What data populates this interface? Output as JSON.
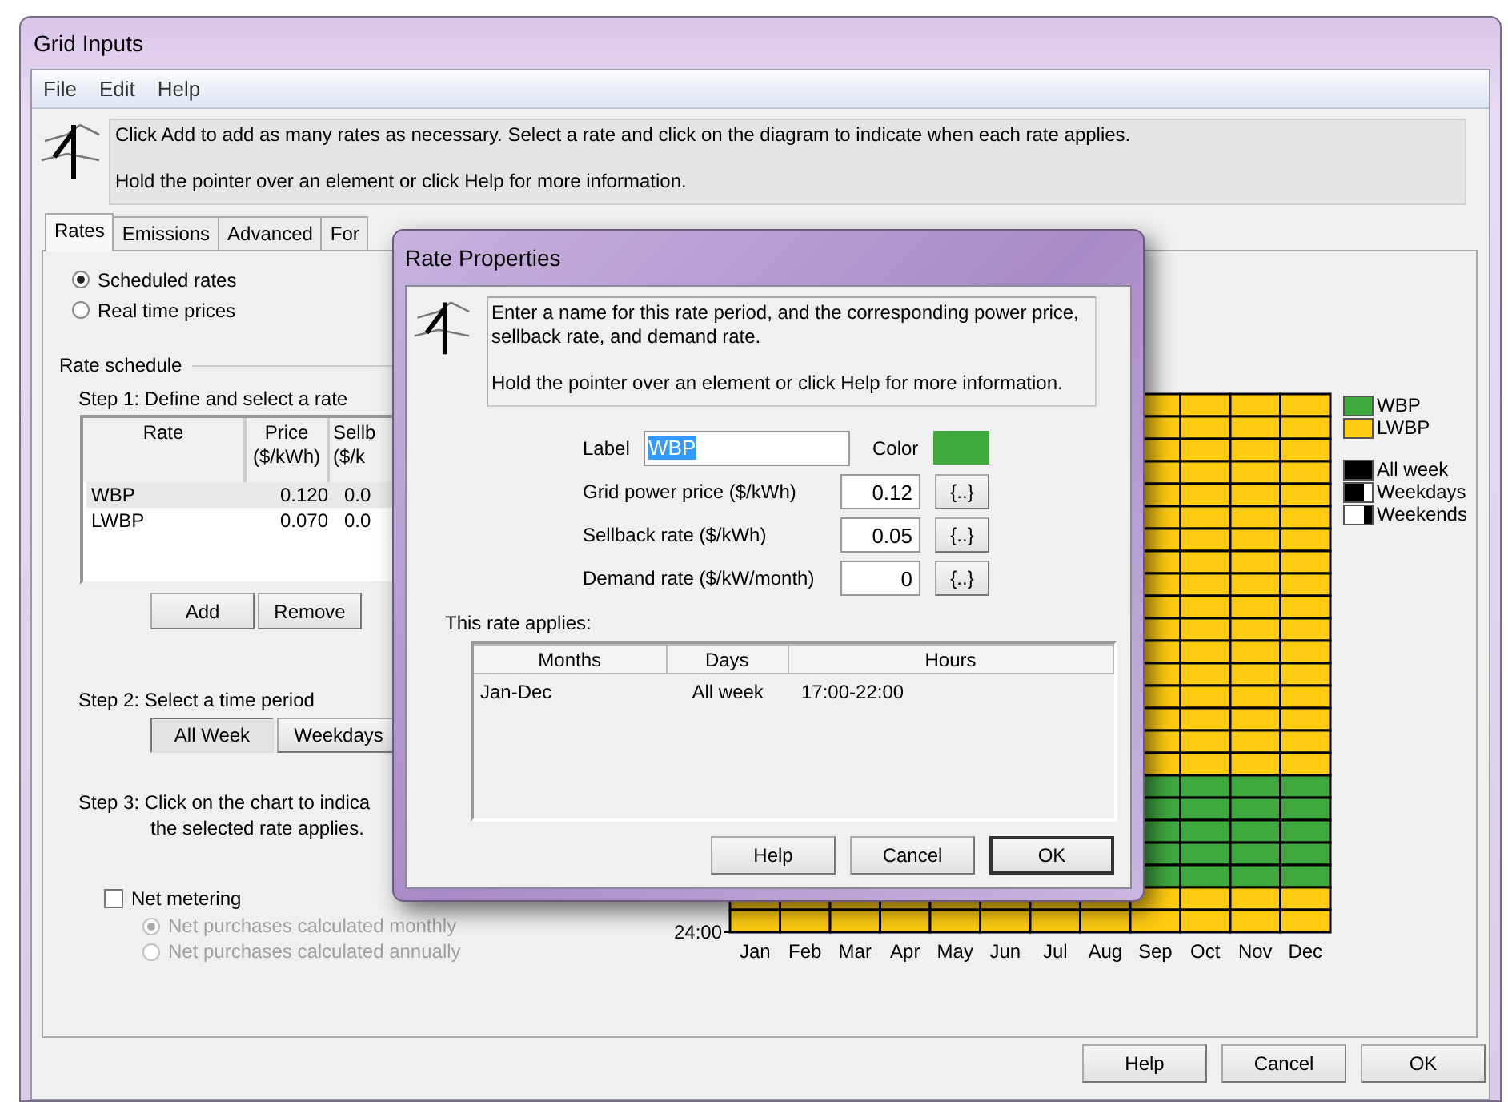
{
  "window": {
    "title": "Grid Inputs"
  },
  "menu": [
    "File",
    "Edit",
    "Help"
  ],
  "info": [
    "Click Add to add as many rates as necessary.  Select a rate and click on the diagram to indicate when each rate applies.",
    "Hold the pointer over an element or click Help for more information."
  ],
  "tabs": [
    {
      "label": "Rates",
      "selected": true
    },
    {
      "label": "Emissions",
      "selected": false
    },
    {
      "label": "Advanced",
      "selected": false
    },
    {
      "label": "For",
      "selected": false
    }
  ],
  "rate_type": [
    {
      "label": "Scheduled rates",
      "selected": true
    },
    {
      "label": "Real time prices",
      "selected": false
    }
  ],
  "rate_schedule": {
    "title": "Rate schedule",
    "step1": "Step 1:  Define and select a rate",
    "columns": [
      {
        "lines": [
          "Rate"
        ]
      },
      {
        "lines": [
          "Price",
          "($/kWh)"
        ]
      },
      {
        "lines": [
          "Sellb",
          "($/k"
        ]
      }
    ],
    "rows": [
      {
        "cells": [
          "WBP",
          "0.120",
          "0.0"
        ],
        "selected": true
      },
      {
        "cells": [
          "LWBP",
          "0.070",
          "0.0"
        ],
        "selected": false
      }
    ],
    "buttons": [
      "Add",
      "Remove"
    ],
    "step2": "Step 2:  Select a time period",
    "periods": [
      {
        "label": "All Week",
        "selected": true
      },
      {
        "label": "Weekdays",
        "selected": false
      }
    ],
    "step3": [
      "Step 3:  Click on the chart to indica",
      "the selected rate applies."
    ]
  },
  "net_metering": {
    "label": "Net metering",
    "checked": false,
    "options": [
      {
        "label": "Net purchases calculated monthly",
        "selected": true,
        "disabled": true
      },
      {
        "label": "Net purchases calculated annually",
        "selected": false,
        "disabled": true
      }
    ]
  },
  "chart": {
    "hour_label": "24:00",
    "months": [
      "Jan",
      "Feb",
      "Mar",
      "Apr",
      "May",
      "Jun",
      "Jul",
      "Aug",
      "Sep",
      "Oct",
      "Nov",
      "Dec"
    ],
    "hours": [
      {
        "kind": "lwbp"
      },
      {
        "kind": "lwbp"
      },
      {
        "kind": "lwbp"
      },
      {
        "kind": "lwbp"
      },
      {
        "kind": "lwbp"
      },
      {
        "kind": "lwbp"
      },
      {
        "kind": "lwbp"
      },
      {
        "kind": "lwbp"
      },
      {
        "kind": "lwbp"
      },
      {
        "kind": "lwbp"
      },
      {
        "kind": "lwbp"
      },
      {
        "kind": "lwbp"
      },
      {
        "kind": "lwbp"
      },
      {
        "kind": "lwbp"
      },
      {
        "kind": "lwbp"
      },
      {
        "kind": "lwbp"
      },
      {
        "kind": "lwbp"
      },
      {
        "kind": "wbp"
      },
      {
        "kind": "wbp"
      },
      {
        "kind": "wbp"
      },
      {
        "kind": "wbp"
      },
      {
        "kind": "wbp"
      },
      {
        "kind": "lwbp"
      },
      {
        "kind": "lwbp"
      }
    ]
  },
  "legend": {
    "rates": [
      {
        "label": "WBP",
        "kind": "wbp",
        "color": "#3fa83f"
      },
      {
        "label": "LWBP",
        "kind": "lwbp",
        "color": "#ffcc11"
      }
    ],
    "days": [
      {
        "label": "All week",
        "kind": "all"
      },
      {
        "label": "Weekdays",
        "kind": "weekdays"
      },
      {
        "label": "Weekends",
        "kind": "weekends"
      }
    ]
  },
  "footer_buttons": [
    "Help",
    "Cancel",
    "OK"
  ],
  "dialog": {
    "title": "Rate Properties",
    "info": [
      "Enter a name for this rate period, and the corresponding power price, sellback rate, and demand rate.",
      "Hold the pointer over an element or click Help for more information."
    ],
    "label": {
      "caption": "Label",
      "value": "WBP"
    },
    "color": {
      "caption": "Color",
      "color": "#3fa83f"
    },
    "fields": [
      {
        "label": "Grid power price ($/kWh)",
        "value": "0.12",
        "button": "{..}"
      },
      {
        "label": "Sellback rate ($/kWh)",
        "value": "0.05",
        "button": "{..}"
      },
      {
        "label": "Demand rate ($/kW/month)",
        "value": "0",
        "button": "{..}"
      }
    ],
    "applies": {
      "title": "This rate applies:",
      "columns": [
        "Months",
        "Days",
        "Hours"
      ],
      "rows": [
        [
          "Jan-Dec",
          "All week",
          "17:00-22:00"
        ]
      ]
    },
    "buttons": [
      {
        "label": "Help",
        "default": false
      },
      {
        "label": "Cancel",
        "default": false
      },
      {
        "label": "OK",
        "default": true
      }
    ]
  }
}
